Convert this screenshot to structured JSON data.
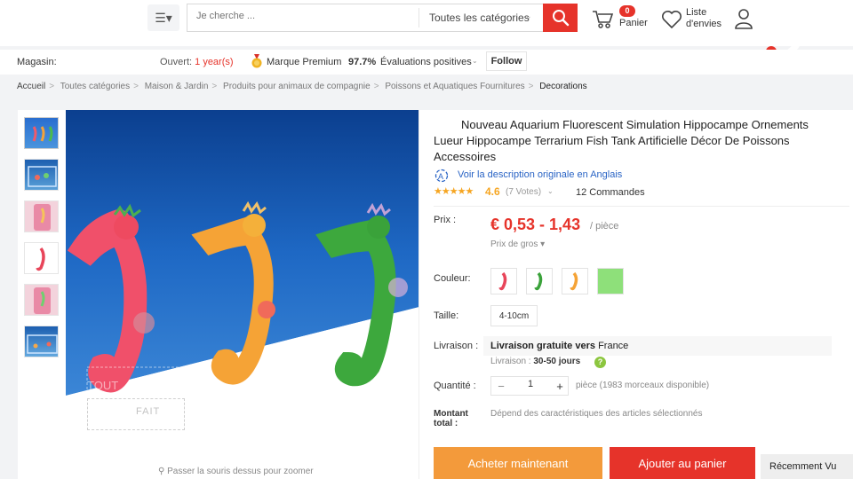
{
  "header": {
    "search_placeholder": "Je cherche ...",
    "category": "Toutes les catégories",
    "cart_count": "0",
    "cart_label": "Panier",
    "wishlist_line1": "Liste",
    "wishlist_line2": "d'envies"
  },
  "store": {
    "label": "Magasin:",
    "open_label": "Ouvert:",
    "open_value": "1 year(s)",
    "premium": "Marque Premium",
    "rating_pct": "97.7%",
    "rating_label": "Évaluations positives",
    "follow": "Follow"
  },
  "breadcrumb": [
    "Accueil",
    "Toutes catégories",
    "Maison & Jardin",
    "Produits pour animaux de compagnie",
    "Poissons et Aquatiques Fournitures",
    "Decorations"
  ],
  "gallery": {
    "zoom_hint": "Passer la souris dessus pour zoomer",
    "overlay_text_1": "TOUT",
    "overlay_text_2": "COMPTE",
    "overlay_text_3": "FAIT"
  },
  "product": {
    "title": "Nouveau Aquarium Fluorescent Simulation Hippocampe Ornements Lueur Hippocampe Terrarium Fish Tank Artificielle Décor De Poissons Accessoires",
    "translate": "Voir la description originale en Anglais",
    "stars": "★★★★★",
    "score": "4.6",
    "votes": "(7 Votes)",
    "orders": "12 Commandes",
    "price_label": "Prix :",
    "price": "€ 0,53 - 1,43",
    "per": "/ pièce",
    "bulk": "Prix de gros ▾",
    "color_label": "Couleur:",
    "size_label": "Taille:",
    "size": "4-10cm",
    "shipping_label": "Livraison :",
    "shipping_main": "Livraison gratuite vers",
    "shipping_country": "France",
    "shipping_time_label": "Livraison :",
    "shipping_days": "30-50 jours",
    "qty_label": "Quantité :",
    "qty": "1",
    "qty_info": "pièce (1983 morceaux disponible)",
    "total_label_1": "Montant",
    "total_label_2": "total :",
    "total_note": "Dépend des caractéristiques des articles sélectionnés",
    "buy": "Acheter maintenant",
    "add_cart": "Ajouter au panier"
  },
  "recent": "Récemment Vu",
  "colors": {
    "accent": "#e6332a",
    "buy_orange": "#f39a3b",
    "link_blue": "#2a64c5",
    "star": "#f6a623"
  }
}
